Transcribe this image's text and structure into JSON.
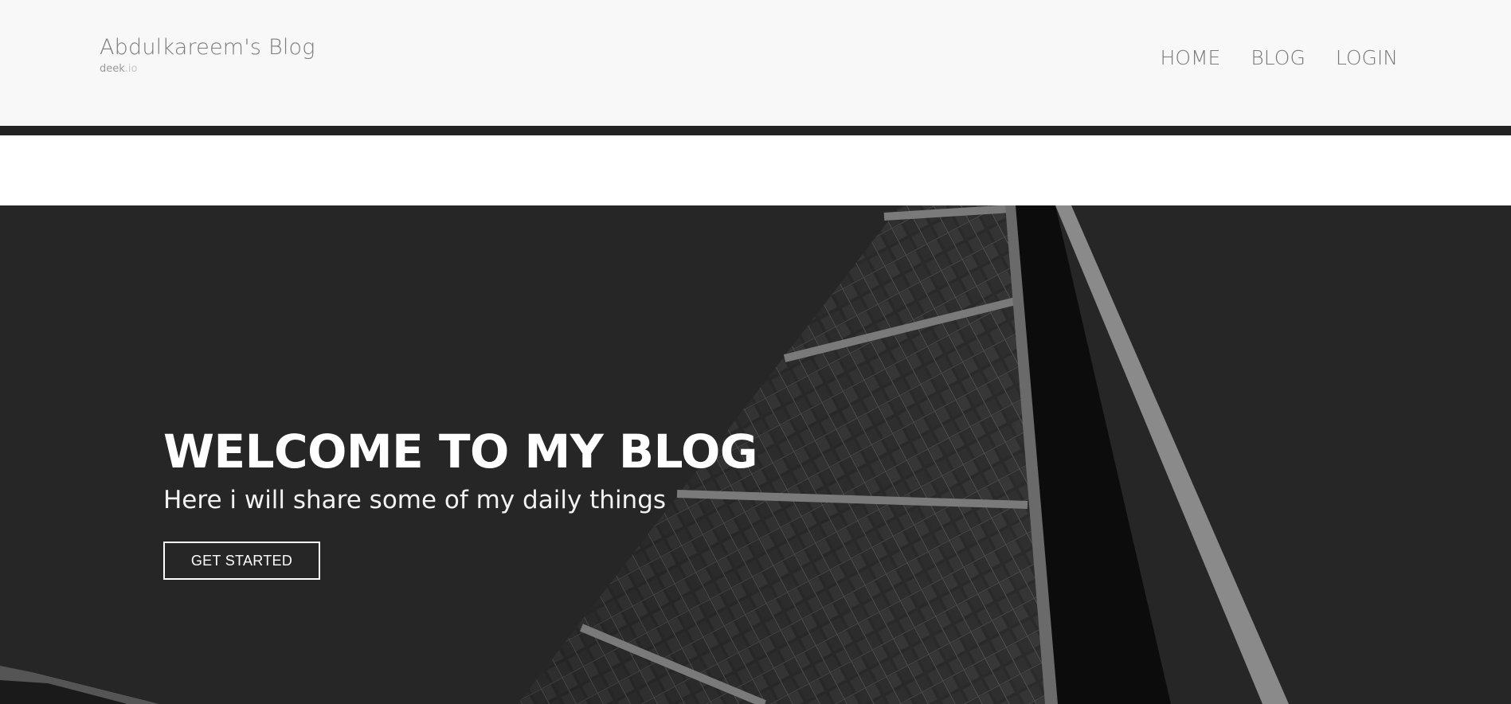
{
  "header": {
    "brand_title": "Abdulkareem's Blog",
    "brand_sub_main": "deek",
    "brand_sub_suffix": ".io",
    "nav": [
      {
        "label": "HOME"
      },
      {
        "label": "BLOG"
      },
      {
        "label": "LOGIN"
      }
    ]
  },
  "hero": {
    "title": "WELCOME TO MY BLOG",
    "subtitle": "Here i will share some of my daily things",
    "cta_label": "GET STARTED"
  },
  "colors": {
    "header_bg": "#f8f8f8",
    "header_border": "#222222",
    "hero_bg": "#262626",
    "text_light": "#ffffff"
  }
}
